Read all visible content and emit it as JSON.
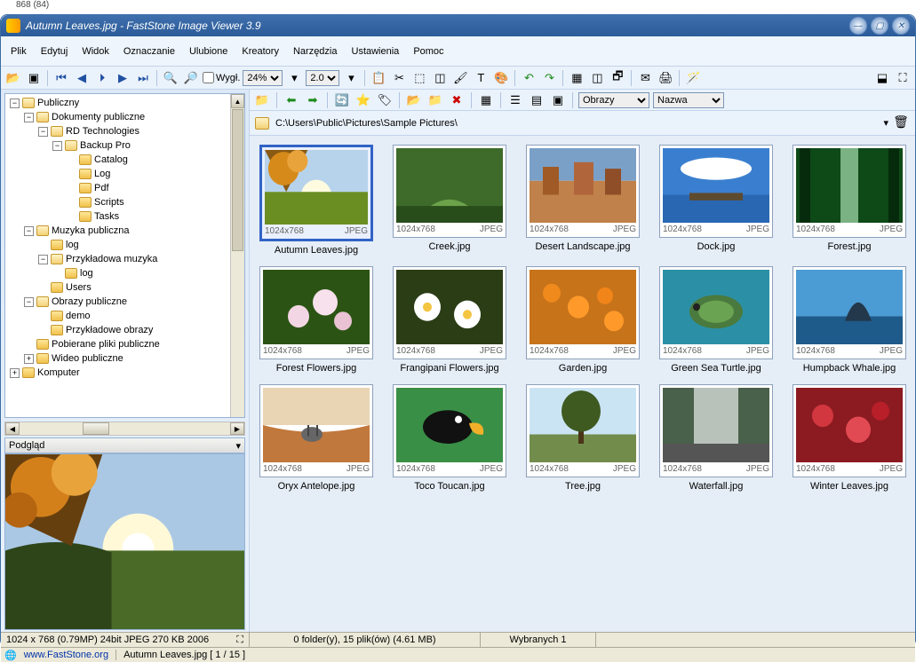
{
  "external_label": "868 (84)",
  "title": "Autumn Leaves.jpg  -  FastStone Image Viewer 3.9",
  "menu": [
    "Plik",
    "Edytuj",
    "Widok",
    "Oznaczanie",
    "Ulubione",
    "Kreatory",
    "Narzędzia",
    "Ustawienia",
    "Pomoc"
  ],
  "toolbar": {
    "zoom1": "24%",
    "zoom2": "2.0",
    "view_label": "Wygł."
  },
  "secondary": {
    "browse_label": "Obrazy",
    "sort_label": "Nazwa"
  },
  "path": "C:\\Users\\Public\\Pictures\\Sample Pictures\\",
  "tree": {
    "root": "Publiczny",
    "n1": "Dokumenty publiczne",
    "n2": "RD Technologies",
    "n3": "Backup Pro",
    "n3a": "Catalog",
    "n3b": "Log",
    "n3c": "Pdf",
    "n3d": "Scripts",
    "n3e": "Tasks",
    "n4": "Muzyka publiczna",
    "n4a": "log",
    "n4b": "Przykładowa muzyka",
    "n4b1": "log",
    "n4c": "Users",
    "n5": "Obrazy publiczne",
    "n5a": "demo",
    "n5b": "Przykładowe obrazy",
    "n6": "Pobierane pliki publiczne",
    "n7": "Wideo publiczne",
    "n8": "Komputer"
  },
  "preview_header": "Podgląd",
  "thumbs": [
    {
      "name": "Autumn Leaves.jpg",
      "dim": "1024x768",
      "fmt": "JPEG",
      "selected": true
    },
    {
      "name": "Creek.jpg",
      "dim": "1024x768",
      "fmt": "JPEG"
    },
    {
      "name": "Desert Landscape.jpg",
      "dim": "1024x768",
      "fmt": "JPEG"
    },
    {
      "name": "Dock.jpg",
      "dim": "1024x768",
      "fmt": "JPEG"
    },
    {
      "name": "Forest.jpg",
      "dim": "1024x768",
      "fmt": "JPEG"
    },
    {
      "name": "Forest Flowers.jpg",
      "dim": "1024x768",
      "fmt": "JPEG"
    },
    {
      "name": "Frangipani Flowers.jpg",
      "dim": "1024x768",
      "fmt": "JPEG"
    },
    {
      "name": "Garden.jpg",
      "dim": "1024x768",
      "fmt": "JPEG"
    },
    {
      "name": "Green Sea Turtle.jpg",
      "dim": "1024x768",
      "fmt": "JPEG"
    },
    {
      "name": "Humpback Whale.jpg",
      "dim": "1024x768",
      "fmt": "JPEG"
    },
    {
      "name": "Oryx Antelope.jpg",
      "dim": "1024x768",
      "fmt": "JPEG"
    },
    {
      "name": "Toco Toucan.jpg",
      "dim": "1024x768",
      "fmt": "JPEG"
    },
    {
      "name": "Tree.jpg",
      "dim": "1024x768",
      "fmt": "JPEG"
    },
    {
      "name": "Waterfall.jpg",
      "dim": "1024x768",
      "fmt": "JPEG"
    },
    {
      "name": "Winter Leaves.jpg",
      "dim": "1024x768",
      "fmt": "JPEG"
    }
  ],
  "thumb_svgs": [
    "<svg viewBox='0 0 120 80' preserveAspectRatio='none'><rect width='120' height='45' fill='#b7d3ec'/><circle cx='60' cy='50' r='18' fill='#fffbe0'/><rect y='45' width='120' height='35' fill='#6b8e23'/><path d='M0 0 L50 0 L25 45 Z' fill='#8a5a14'/><circle cx='22' cy='20' r='18' fill='#d68a1a'/><circle cx='38' cy='12' r='12' fill='#e8a33b'/></svg>",
    "<svg viewBox='0 0 120 80' preserveAspectRatio='none'><rect width='120' height='80' fill='#3e6b2a'/><path d='M20 80 Q60 30 100 80 Z' fill='#6ba24a'/><rect y='62' width='120' height='18' fill='#284d1b'/></svg>",
    "<svg viewBox='0 0 120 80' preserveAspectRatio='none'><rect width='120' height='35' fill='#7aa0c8'/><rect y='35' width='120' height='45' fill='#c0814a'/><rect x='15' y='20' width='18' height='30' fill='#a05a25'/><rect x='50' y='15' width='22' height='35' fill='#b0663a'/><rect x='85' y='22' width='18' height='28' fill='#8f4e27'/></svg>",
    "<svg viewBox='0 0 120 80' preserveAspectRatio='none'><rect width='120' height='50' fill='#3a7fcf'/><ellipse cx='60' cy='22' rx='40' ry='12' fill='#fff'/><rect y='50' width='120' height='30' fill='#2967b2'/><rect x='30' y='48' width='60' height='8' fill='#5e4a2e'/></svg>",
    "<svg viewBox='0 0 120 80' preserveAspectRatio='none'><rect width='120' height='80' fill='#0e4918'/><rect x='50' y='0' width='20' height='80' fill='#a9dfb0' opacity='0.7'/><rect x='4' y='0' width='12' height='80' fill='#062b0c'/><rect x='104' y='0' width='12' height='80' fill='#062b0c'/></svg>",
    "<svg viewBox='0 0 120 80' preserveAspectRatio='none'><rect width='120' height='80' fill='#2b5414'/><circle cx='40' cy='50' r='12' fill='#f3d6e3'/><circle cx='70' cy='35' r='14' fill='#f7e1ec'/><circle cx='90' cy='55' r='10' fill='#e9c2d3'/></svg>",
    "<svg viewBox='0 0 120 80' preserveAspectRatio='none'><rect width='120' height='80' fill='#2a3d15'/><circle cx='35' cy='40' r='15' fill='#fff'/><circle cx='35' cy='40' r='5' fill='#f4c542'/><circle cx='80' cy='48' r='15' fill='#fff'/><circle cx='80' cy='48' r='5' fill='#f4c542'/></svg>",
    "<svg viewBox='0 0 120 80' preserveAspectRatio='none'><rect width='120' height='80' fill='#c7731a'/><circle cx='25' cy='25' r='10' fill='#f08a1c'/><circle cx='55' cy='40' r='12' fill='#ff9a2a'/><circle cx='85' cy='28' r='9' fill='#f28519'/><circle cx='95' cy='55' r='11' fill='#ff9a2a'/></svg>",
    "<svg viewBox='0 0 120 80' preserveAspectRatio='none'><rect width='120' height='80' fill='#2b90a6'/><ellipse cx='60' cy='45' rx='30' ry='18' fill='#4a7a3e'/><ellipse cx='60' cy='45' rx='20' ry='12' fill='#6aa351'/><circle cx='38' cy='40' r='4' fill='#222'/></svg>",
    "<svg viewBox='0 0 120 80' preserveAspectRatio='none'><rect width='120' height='50' fill='#4b9bd4'/><rect y='50' width='120' height='30' fill='#1e5a8a'/><path d='M55 55 Q70 15 85 55 Z' fill='#23384b'/></svg>",
    "<svg viewBox='0 0 120 80' preserveAspectRatio='none'><rect width='120' height='40' fill='#e9d5b4'/><path d='M0 40 Q60 55 120 40 L120 80 L0 80 Z' fill='#c1783c'/><ellipse cx='55' cy='50' rx='12' ry='8' fill='#666'/><rect x='50' y='40' width='2' height='12' fill='#444'/><rect x='60' y='40' width='2' height='12' fill='#444'/></svg>",
    "<svg viewBox='0 0 120 80' preserveAspectRatio='none'><rect width='120' height='80' fill='#3a8f46'/><ellipse cx='58' cy='42' rx='28' ry='18' fill='#111'/><path d='M82 38 Q100 35 98 50 Q85 52 82 38 Z' fill='#f2b02a'/><circle cx='70' cy='34' r='4' fill='#fff'/></svg>",
    "<svg viewBox='0 0 120 80' preserveAspectRatio='none'><rect width='120' height='50' fill='#cbe4f3'/><rect y='50' width='120' height='30' fill='#728c4c'/><rect x='55' y='30' width='6' height='30' fill='#4a3518'/><circle cx='58' cy='25' r='22' fill='#3e5a21'/></svg>",
    "<svg viewBox='0 0 120 80' preserveAspectRatio='none'><rect width='120' height='80' fill='#49604a'/><rect x='35' y='0' width='50' height='80' fill='#e8ece9' opacity='0.7'/><rect y='60' width='120' height='20' fill='#555'/></svg>",
    "<svg viewBox='0 0 120 80' preserveAspectRatio='none'><rect width='120' height='80' fill='#8c1a21'/><circle cx='30' cy='30' r='12' fill='#d23740'/><circle cx='70' cy='45' r='14' fill='#e24a53'/><circle cx='95' cy='25' r='10' fill='#b91f29'/></svg>"
  ],
  "status": {
    "info1": "1024 x 768 (0.79MP)   24bit JPEG   270 KB   2006",
    "info2": "0 folder(y), 15 plik(ów) (4.61 MB)",
    "info3": "Wybranych 1"
  },
  "bottom": {
    "link": "www.FastStone.org",
    "file_status": "Autumn Leaves.jpg [ 1 / 15 ]"
  }
}
